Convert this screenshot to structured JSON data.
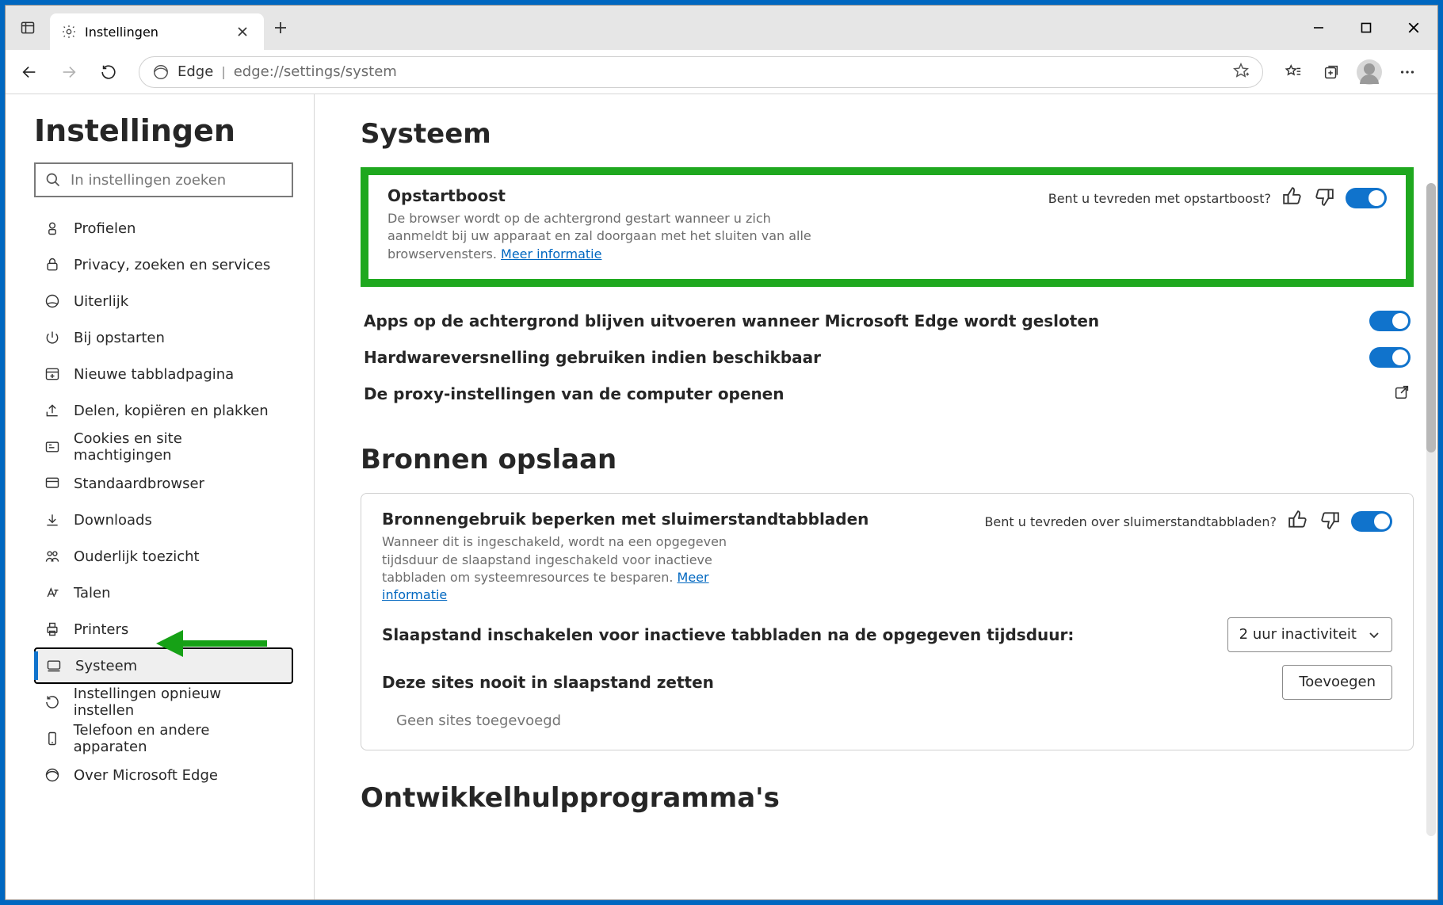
{
  "tab": {
    "title": "Instellingen"
  },
  "addressbar": {
    "label": "Edge",
    "url": "edge://settings/system"
  },
  "sidebar": {
    "heading": "Instellingen",
    "search_placeholder": "In instellingen zoeken",
    "items": [
      {
        "label": "Profielen"
      },
      {
        "label": "Privacy, zoeken en services"
      },
      {
        "label": "Uiterlijk"
      },
      {
        "label": "Bij opstarten"
      },
      {
        "label": "Nieuwe tabbladpagina"
      },
      {
        "label": "Delen, kopiëren en plakken"
      },
      {
        "label": "Cookies en site machtigingen"
      },
      {
        "label": "Standaardbrowser"
      },
      {
        "label": "Downloads"
      },
      {
        "label": "Ouderlijk toezicht"
      },
      {
        "label": "Talen"
      },
      {
        "label": "Printers"
      },
      {
        "label": "Systeem"
      },
      {
        "label": "Instellingen opnieuw instellen"
      },
      {
        "label": "Telefoon en andere apparaten"
      },
      {
        "label": "Over Microsoft Edge"
      }
    ]
  },
  "main": {
    "heading_system": "Systeem",
    "startup_boost": {
      "title": "Opstartboost",
      "desc": "De browser wordt op de achtergrond gestart wanneer u zich aanmeldt bij uw apparaat en zal doorgaan met het sluiten van alle browservensters.",
      "more": "Meer informatie",
      "feedback_q": "Bent u tevreden met opstartboost?"
    },
    "bg_apps": "Apps op de achtergrond blijven uitvoeren wanneer Microsoft Edge wordt gesloten",
    "hw_accel": "Hardwareversnelling gebruiken indien beschikbaar",
    "proxy": "De proxy-instellingen van de computer openen",
    "heading_resources": "Bronnen opslaan",
    "sleeping_tabs": {
      "title": "Bronnengebruik beperken met sluimerstandtabbladen",
      "desc": "Wanneer dit is ingeschakeld, wordt na een opgegeven tijdsduur de slaapstand ingeschakeld voor inactieve tabbladen om systeemresources te besparen.",
      "more": "Meer informatie",
      "feedback_q": "Bent u tevreden over sluimerstandtabbladen?",
      "sleep_after_label": "Slaapstand inschakelen voor inactieve tabbladen na de opgegeven tijdsduur:",
      "sleep_after_value": "2 uur inactiviteit",
      "never_sleep_label": "Deze sites nooit in slaapstand zetten",
      "add_btn": "Toevoegen",
      "empty": "Geen sites toegevoegd"
    },
    "heading_dev": "Ontwikkelhulpprogramma's"
  }
}
